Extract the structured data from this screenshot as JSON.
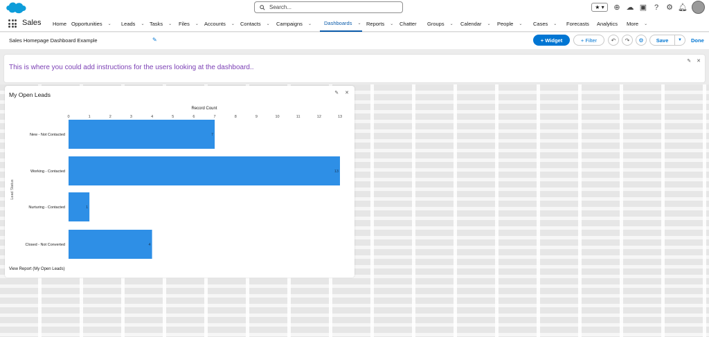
{
  "header": {
    "search_placeholder": "Search...",
    "icons": [
      "favorites-star-icon",
      "add-icon",
      "trailhead-icon",
      "setup-box-icon",
      "help-icon",
      "gear-icon",
      "bell-icon",
      "avatar"
    ]
  },
  "nav": {
    "app_name": "Sales",
    "items": [
      {
        "label": "Home",
        "chevron": false
      },
      {
        "label": "Opportunities",
        "chevron": true
      },
      {
        "label": "Leads",
        "chevron": true
      },
      {
        "label": "Tasks",
        "chevron": true
      },
      {
        "label": "Files",
        "chevron": true
      },
      {
        "label": "Accounts",
        "chevron": true
      },
      {
        "label": "Contacts",
        "chevron": true
      },
      {
        "label": "Campaigns",
        "chevron": true
      },
      {
        "label": "Dashboards",
        "chevron": true,
        "active": true
      },
      {
        "label": "Reports",
        "chevron": true
      },
      {
        "label": "Chatter",
        "chevron": false
      },
      {
        "label": "Groups",
        "chevron": true
      },
      {
        "label": "Calendar",
        "chevron": true
      },
      {
        "label": "People",
        "chevron": true
      },
      {
        "label": "Cases",
        "chevron": true
      },
      {
        "label": "Forecasts",
        "chevron": false
      },
      {
        "label": "Analytics",
        "chevron": false
      },
      {
        "label": "More",
        "chevron": true
      }
    ]
  },
  "dashboard": {
    "title": "Sales Homepage Dashboard Example",
    "widget_label": "+ Widget",
    "filter_label": "+ Filter",
    "save_label": "Save",
    "done_label": "Done"
  },
  "instructions": {
    "text": "This is where you could add instructions for the users looking at the dashboard.."
  },
  "widget": {
    "title": "My Open Leads",
    "view_report": "View Report (My Open Leads)"
  },
  "chart_data": {
    "type": "bar",
    "orientation": "horizontal",
    "title": "",
    "xlabel": "Record Count",
    "ylabel": "Lead Status",
    "categories": [
      "New - Not Contacted",
      "Working - Contacted",
      "Nurturing - Contacted",
      "Closed - Not Converted"
    ],
    "values": [
      7,
      13,
      1,
      4
    ],
    "xlim": [
      0,
      13
    ],
    "xticks": [
      0,
      1,
      2,
      3,
      4,
      5,
      6,
      7,
      8,
      9,
      10,
      11,
      12,
      13
    ],
    "bar_color": "#2e8fe6",
    "grid": false
  }
}
